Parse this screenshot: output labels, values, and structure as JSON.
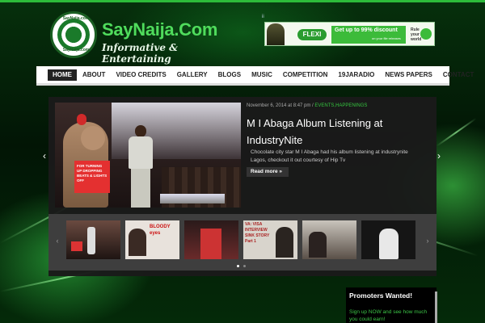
{
  "header": {
    "logo_title": "SayNaija.Com",
    "logo_tagline": "Informative & Entertaining",
    "seal_top": "SayNaija.com",
    "seal_bottom": "SayNaija.com"
  },
  "ad": {
    "brand": "FLEXI",
    "offer": "Get up to 99% discount",
    "offer_sub": "on your file releases",
    "rule": "Rule your world",
    "marker": "ii"
  },
  "nav": {
    "items": [
      {
        "label": "HOME",
        "active": true
      },
      {
        "label": "ABOUT"
      },
      {
        "label": "VIDEO CREDITS"
      },
      {
        "label": "GALLERY"
      },
      {
        "label": "BLOGS"
      },
      {
        "label": "MUSIC"
      },
      {
        "label": "COMPETITION"
      },
      {
        "label": "19JARADIO"
      },
      {
        "label": "NEWS PAPERS"
      },
      {
        "label": "CONTACT"
      }
    ]
  },
  "slider": {
    "meta_date": "November 6, 2014 at 8:47 pm / ",
    "meta_categories": "EVENTS,HAPPENINGS",
    "title": "M I Abaga Album Listening at IndustryNite",
    "excerpt": "Chocolate city star M I Abaga had his album listening at industrynite Lagos, checkout it out courtesy of Hip Tv",
    "read_more": "Read more »",
    "sign_text": "FOR TURNING UP DROPPING BEATS & LIGHTS OFF",
    "prev_arrow": "‹",
    "next_arrow": "›"
  },
  "carousel": {
    "prev": "‹",
    "next": "›",
    "thumbs": [
      {
        "name": "thumb-mi-abaga",
        "caption": ""
      },
      {
        "name": "thumb-bloody-eyes",
        "caption": "BLOODY eyes"
      },
      {
        "name": "thumb-event",
        "caption": ""
      },
      {
        "name": "thumb-interview",
        "caption": "VA: VISA INTERVIEW SINK STORY Part 1"
      },
      {
        "name": "thumb-movie",
        "caption": ""
      },
      {
        "name": "thumb-artist",
        "caption": ""
      }
    ],
    "active_dot": 0,
    "dot_count": 2
  },
  "widget": {
    "title": "Promoters Wanted!",
    "body": "Sign up NOW and see how much you could earn!"
  },
  "colors": {
    "accent": "#35c43f",
    "nav_bg": "#ffffff",
    "content_bg": "#1a1a1a"
  }
}
